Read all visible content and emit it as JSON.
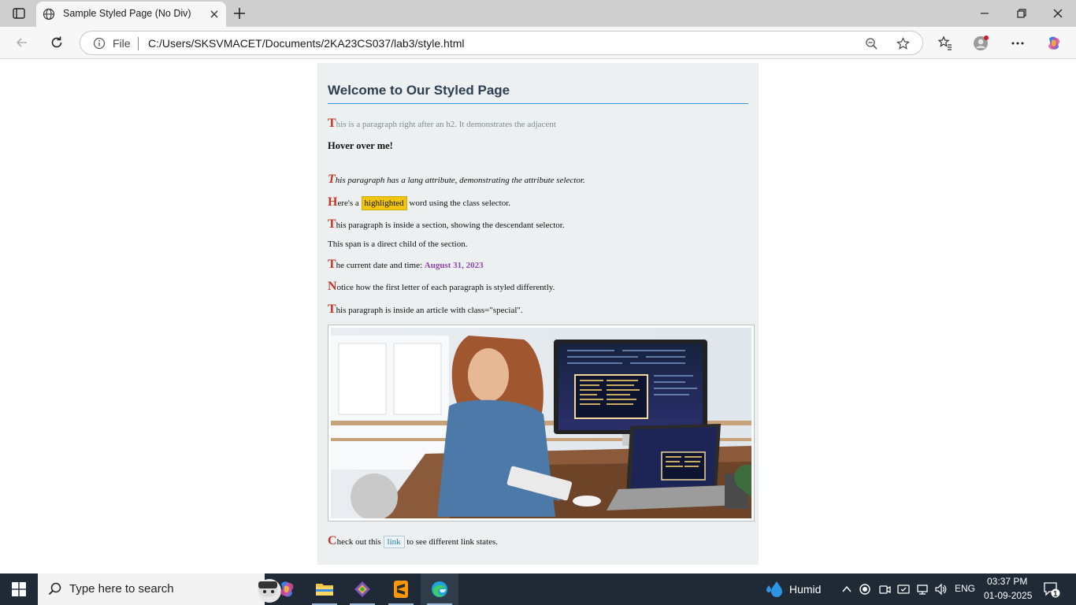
{
  "browser": {
    "tab_title": "Sample Styled Page (No Div)",
    "omnibox": {
      "scheme_label": "File",
      "url": "C:/Users/SKSVMACET/Documents/2KA23CS037/lab3/style.html"
    }
  },
  "page": {
    "heading": "Welcome to Our Styled Page",
    "p1": {
      "first": "T",
      "rest": "his is a paragraph right after an h2. It demonstrates the adjacent"
    },
    "hover_text": "Hover over me!",
    "p_lang": {
      "first": "T",
      "rest": "his paragraph has a lang attribute, demonstrating the attribute selector."
    },
    "p_highlight": {
      "first": "H",
      "before": "ere's a ",
      "highlight": "highlighted",
      "after": " word using the class selector."
    },
    "p_section": {
      "first": "T",
      "rest": "his paragraph is inside a section, showing the descendant selector."
    },
    "span_child": "This span is a direct child of the section.",
    "p_date": {
      "first": "T",
      "rest": "he current date and time: ",
      "date": "August 31, 2023"
    },
    "p_notice": {
      "first": "N",
      "rest": "otice how the first letter of each paragraph is styled differently."
    },
    "p_special": {
      "first": "T",
      "rest": "his paragraph is inside an article with class=\"special\"."
    },
    "p_link": {
      "first": "C",
      "before": "heck out this ",
      "link": "link",
      "after": " to see different link states."
    }
  },
  "taskbar": {
    "search_placeholder": "Type here to search",
    "weather": "Humid",
    "lang": "ENG",
    "time": "03:37 PM",
    "date": "01-09-2025",
    "notification_count": "1"
  }
}
